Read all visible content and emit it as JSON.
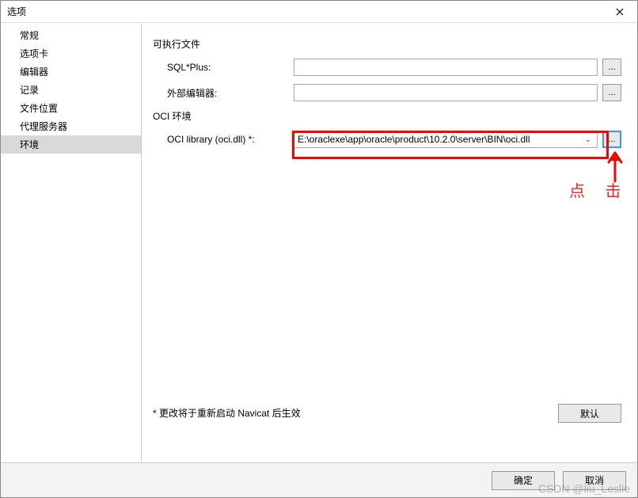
{
  "window": {
    "title": "选项"
  },
  "sidebar": {
    "items": [
      {
        "label": "常规"
      },
      {
        "label": "选项卡"
      },
      {
        "label": "编辑器"
      },
      {
        "label": "记录"
      },
      {
        "label": "文件位置"
      },
      {
        "label": "代理服务器"
      },
      {
        "label": "环境"
      }
    ],
    "selected_index": 6
  },
  "content": {
    "section_executable": "可执行文件",
    "sql_plus_label": "SQL*Plus:",
    "sql_plus_value": "",
    "external_editor_label": "外部编辑器:",
    "external_editor_value": "",
    "section_oci": "OCI 环境",
    "oci_library_label": "OCI library (oci.dll) *:",
    "oci_library_value": "E:\\oraclexe\\app\\oracle\\product\\10.2.0\\server\\BIN\\oci.dll",
    "browse_label": "...",
    "restart_note": "* 更改将于重新启动 Navicat 后生效",
    "defaults_button": "默认"
  },
  "footer": {
    "ok": "确定",
    "cancel": "取消"
  },
  "annotation": {
    "click_text": "点 击"
  },
  "watermark": "CSDN @liu_Leslie"
}
